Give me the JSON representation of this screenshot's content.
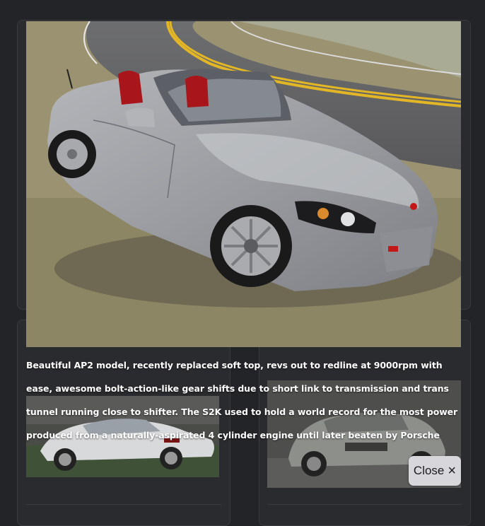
{
  "lightbox": {
    "caption": "Beautiful AP2 model, recently replaced soft top, revs out to redline at 9000rpm with ease, awesome bolt-action-like gear shifts due to short link to transmission and trans tunnel running close to shifter. The S2K used to hold a world record for the most power produced from a naturally-aspirated 4 cylinder engine until later beaten by Porsche",
    "close_label": "Close",
    "close_icon": "×"
  },
  "colors": {
    "page_bg": "#232428",
    "card_bg": "#2a2b2f",
    "button_bg": "#d6d6db"
  }
}
